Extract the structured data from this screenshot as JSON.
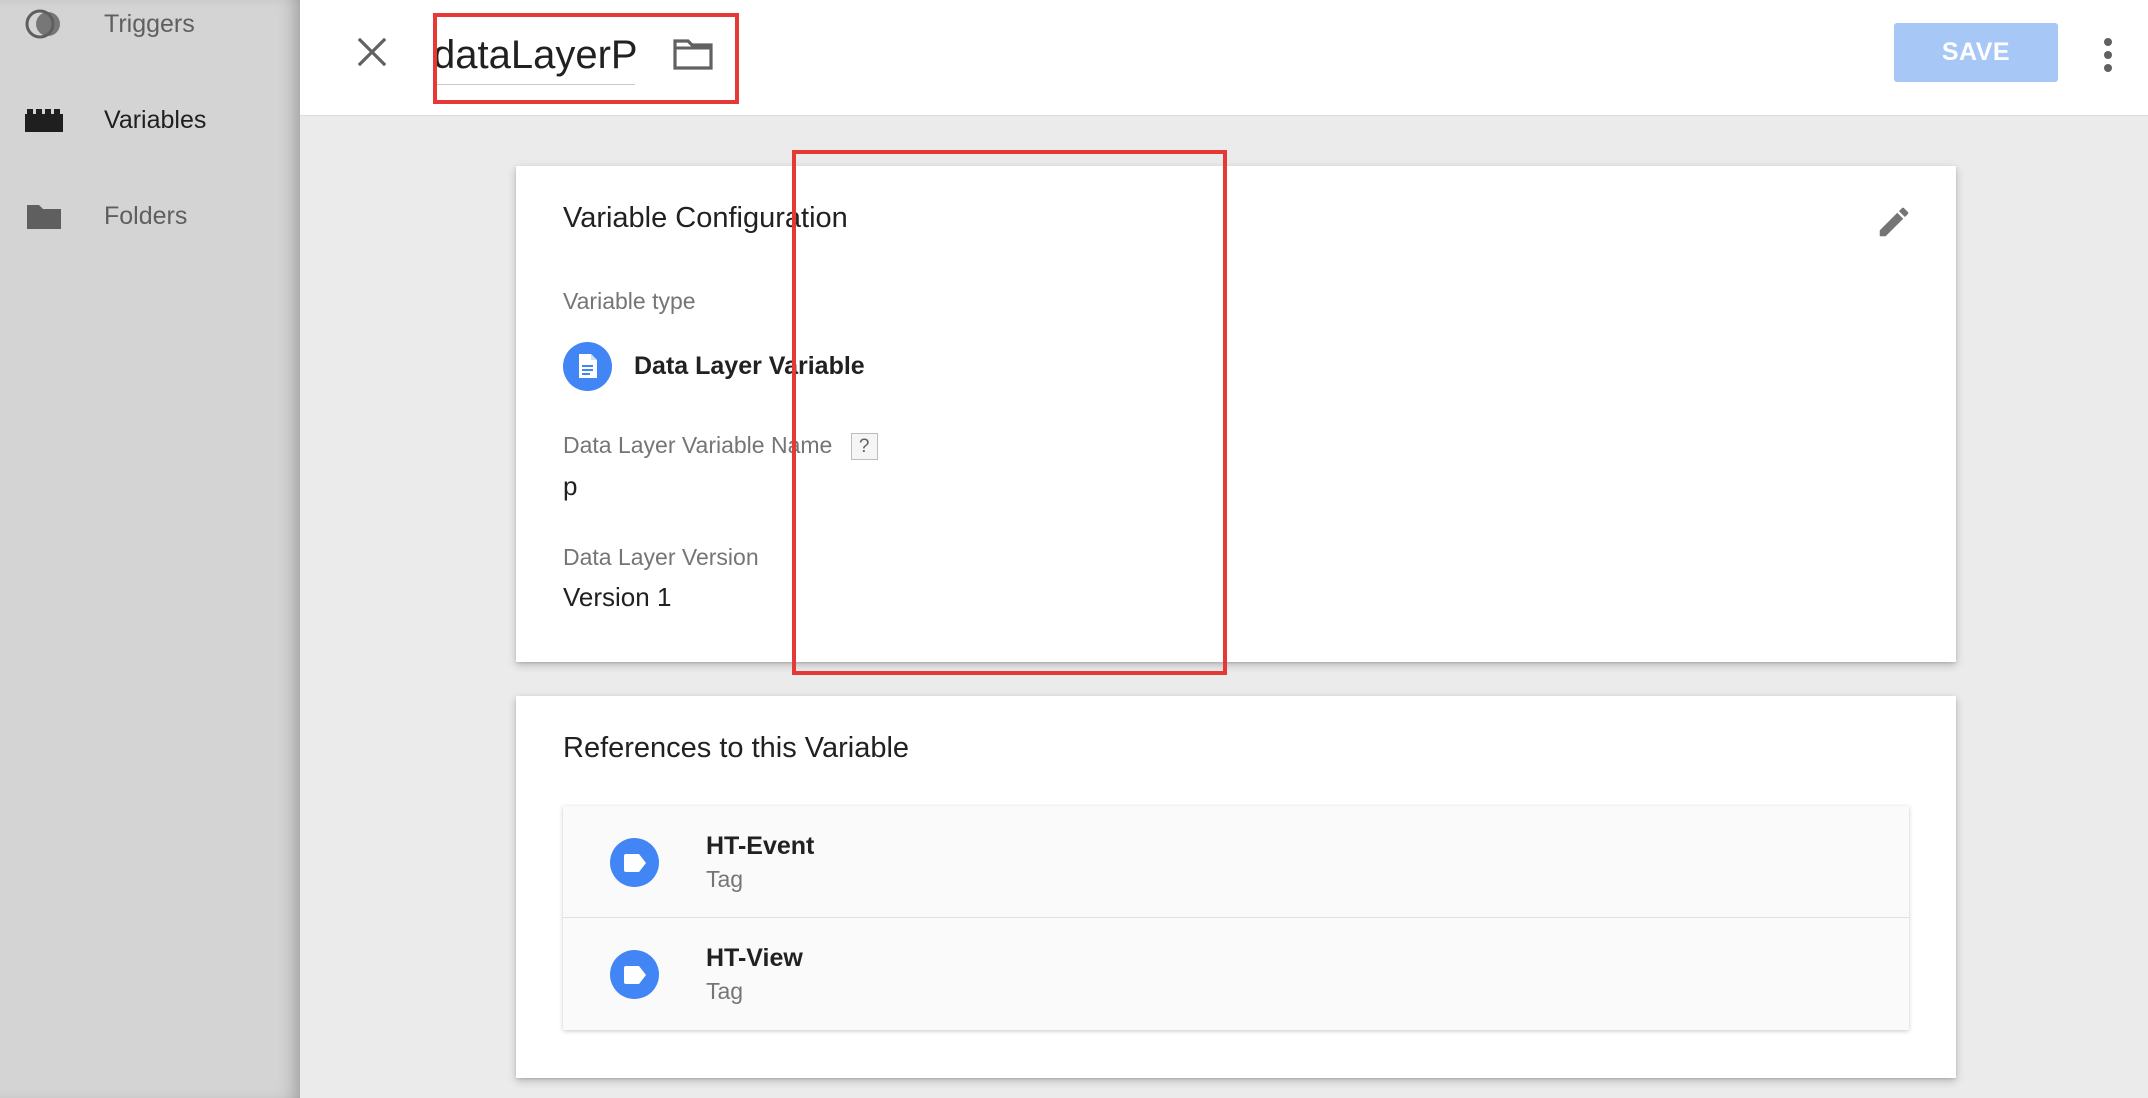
{
  "sidebar": {
    "items": [
      {
        "label": "Triggers",
        "icon": "triggers-icon"
      },
      {
        "label": "Variables",
        "icon": "variables-icon"
      },
      {
        "label": "Folders",
        "icon": "folder-icon"
      }
    ]
  },
  "header": {
    "title": "dataLayerP",
    "save_label": "SAVE"
  },
  "config": {
    "title": "Variable Configuration",
    "type_label": "Variable type",
    "type_name": "Data Layer Variable",
    "name_label": "Data Layer Variable Name",
    "help_label": "?",
    "name_value": "p",
    "version_label": "Data Layer Version",
    "version_value": "Version 1"
  },
  "references": {
    "title": "References to this Variable",
    "items": [
      {
        "name": "HT-Event",
        "type": "Tag"
      },
      {
        "name": "HT-View",
        "type": "Tag"
      }
    ]
  },
  "colors": {
    "accent": "#4285f4",
    "save_disabled": "#a7c7f7",
    "highlight": "#e53935"
  }
}
